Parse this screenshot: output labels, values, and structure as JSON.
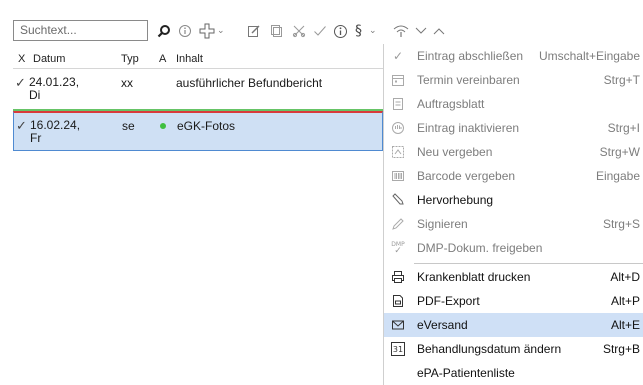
{
  "toolbar": {
    "search_placeholder": "Suchtext...",
    "icons": [
      "search-icon",
      "info-icon",
      "add-icon",
      "chevron-down-icon",
      "edit-icon",
      "copy-icon",
      "delete-icon",
      "check-icon",
      "info-circle-icon",
      "paragraph-icon",
      "chevron-down-icon",
      "signal-icon",
      "chevron-down-icon",
      "chevron-up-icon"
    ]
  },
  "list": {
    "headers": {
      "x": "X",
      "datum": "Datum",
      "typ": "Typ",
      "a": "A",
      "inhalt": "Inhalt"
    },
    "rows": [
      {
        "check": "✓",
        "datum": "24.01.23,\nDi",
        "datum_line1": "24.01.23,",
        "datum_line2": "Di",
        "typ": "xx",
        "a": "",
        "inhalt": "ausführlicher Befundbericht"
      },
      {
        "check": "✓",
        "datum_line1": "16.02.24,",
        "datum_line2": "Fr",
        "typ": "se",
        "a": "●",
        "inhalt": "eGK-Fotos"
      }
    ]
  },
  "menu": {
    "items": [
      {
        "label": "Eintrag abschließen",
        "shortcut": "Umschalt+Eingabe",
        "icon": "check-icon",
        "enabled": false
      },
      {
        "label": "Termin vereinbaren",
        "shortcut": "Strg+T",
        "icon": "calendar-icon",
        "enabled": false
      },
      {
        "label": "Auftragsblatt",
        "shortcut": "",
        "icon": "clipboard-icon",
        "enabled": false
      },
      {
        "label": "Eintrag inaktivieren",
        "shortcut": "Strg+I",
        "icon": "hand-icon",
        "enabled": false
      },
      {
        "label": "Neu vergeben",
        "shortcut": "Strg+W",
        "icon": "reassign-icon",
        "enabled": false
      },
      {
        "label": "Barcode vergeben",
        "shortcut": "Eingabe",
        "icon": "barcode-icon",
        "enabled": false
      },
      {
        "label": "Hervorhebung",
        "shortcut": "",
        "icon": "highlighter-icon",
        "enabled": true
      },
      {
        "label": "Signieren",
        "shortcut": "Strg+S",
        "icon": "pen-icon",
        "enabled": false
      },
      {
        "label": "DMP-Dokum. freigeben",
        "shortcut": "",
        "icon": "dmp-icon",
        "enabled": false
      },
      {
        "label": "Krankenblatt drucken",
        "shortcut": "Alt+D",
        "icon": "print-icon",
        "enabled": true
      },
      {
        "label": "PDF-Export",
        "shortcut": "Alt+P",
        "icon": "pdf-icon",
        "enabled": true
      },
      {
        "label": "eVersand",
        "shortcut": "Alt+E",
        "icon": "mail-icon",
        "enabled": true,
        "highlighted": true
      },
      {
        "label": "Behandlungsdatum ändern",
        "shortcut": "Strg+B",
        "icon": "calendar-31-icon",
        "enabled": true
      },
      {
        "label": "ePA-Patientenliste",
        "shortcut": "",
        "icon": "",
        "enabled": true
      }
    ],
    "dmp_icon_text": "DMP",
    "calendar_icon_text": "31"
  },
  "colors": {
    "selection": "#cfe0f4",
    "menu_highlight": "#cfe0f6",
    "status_dot": "#3fbf3f",
    "row_marker_red": "#d93b3b",
    "row_marker_green": "#66c466"
  }
}
